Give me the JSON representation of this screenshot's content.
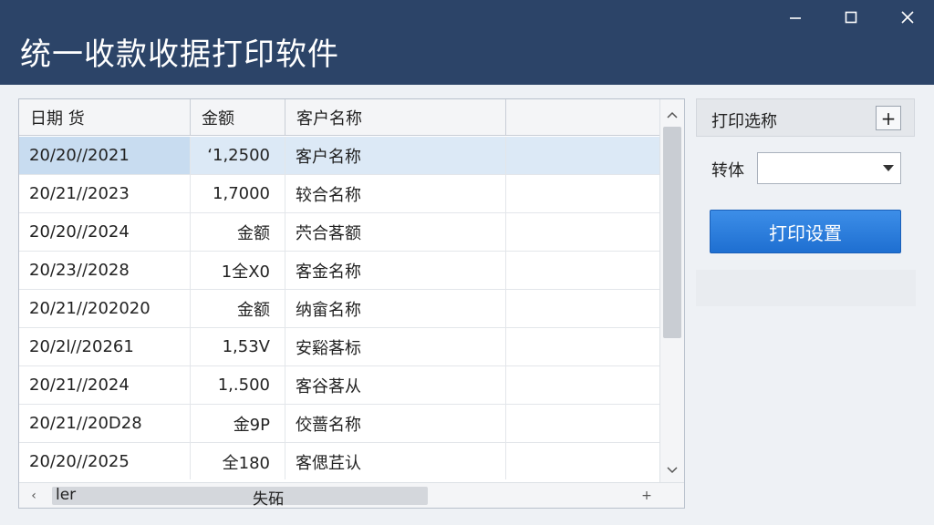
{
  "window": {
    "title": "统一收款收据打印软件",
    "minimize_icon": "minimize-icon",
    "maximize_icon": "maximize-icon",
    "close_icon": "close-icon"
  },
  "colors": {
    "titlebar": "#2c4468",
    "selection": "#dce9f6",
    "primary_button": "#1e6fd1"
  },
  "grid": {
    "columns": [
      "日期 货",
      "金额",
      "客户名称",
      ""
    ],
    "rows": [
      {
        "date": "20/20//2021",
        "amount": "‘1,2500",
        "customer": "客户名称",
        "extra": "",
        "selected": true
      },
      {
        "date": "20/21//2023",
        "amount": "1,7000",
        "customer": "较合名称",
        "extra": ""
      },
      {
        "date": "20/20//2024",
        "amount": "金额",
        "customer": "茓合茖额",
        "extra": ""
      },
      {
        "date": "20/23//2028",
        "amount": "1全X0",
        "customer": "客金名称",
        "extra": ""
      },
      {
        "date": "20/21//202020",
        "amount": "金额",
        "customer": "纳畲名称",
        "extra": ""
      },
      {
        "date": "20/2l//20261",
        "amount": "1,53V",
        "customer": "安谿茖标",
        "extra": ""
      },
      {
        "date": "20/21//2024",
        "amount": "1,.500",
        "customer": "客谷茖从",
        "extra": ""
      },
      {
        "date": "20/21//20D28",
        "amount": "金9P",
        "customer": "佼蔷名称",
        "extra": ""
      },
      {
        "date": "20/20//2025",
        "amount": "全180",
        "customer": "客偲茊认",
        "extra": ""
      }
    ],
    "hscroll": {
      "left_text": "ler",
      "mid_text": "失砳",
      "left_arrow": "‹",
      "right_arrow": "+"
    }
  },
  "panel": {
    "title": "打印选称",
    "add_label": "+",
    "field_label": "转体",
    "select_value": "",
    "print_button": "打印设置"
  }
}
